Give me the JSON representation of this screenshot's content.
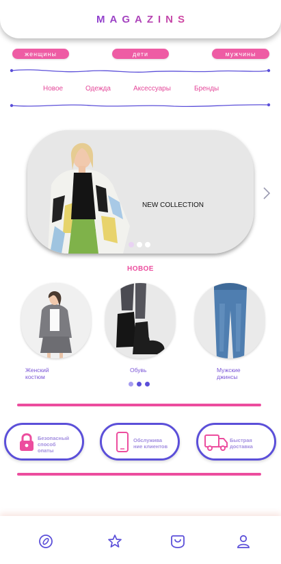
{
  "header": {
    "logo": "MAGAZINS"
  },
  "genders": [
    {
      "label": "женщины"
    },
    {
      "label": "дети"
    },
    {
      "label": "мужчины"
    }
  ],
  "categories": [
    {
      "label": "Новое"
    },
    {
      "label": "Одежда"
    },
    {
      "label": "Аксессуары"
    },
    {
      "label": "Бренды"
    }
  ],
  "hero": {
    "caption": "NEW COLLECTION",
    "slides": 3,
    "active_slide": 1,
    "next_icon": "chevron-right-icon"
  },
  "section": {
    "title": "НОВОЕ"
  },
  "products": [
    {
      "name_line1": "Женский",
      "name_line2": "костюм"
    },
    {
      "name_line1": "Обувь",
      "name_line2": ""
    },
    {
      "name_line1": "Мужские",
      "name_line2": "джинсы"
    }
  ],
  "features": [
    {
      "icon": "lock-icon",
      "line1": "Безопасный",
      "line2": "способ",
      "line3": "опаты"
    },
    {
      "icon": "phone-icon",
      "line1": "Обслужива",
      "line2": "ние клиентов",
      "line3": ""
    },
    {
      "icon": "truck-icon",
      "line1": "Быстрая",
      "line2": "доставка",
      "line3": ""
    }
  ],
  "bottom_nav": [
    {
      "icon": "compass-icon"
    },
    {
      "icon": "star-icon"
    },
    {
      "icon": "bag-icon"
    },
    {
      "icon": "profile-icon"
    }
  ],
  "colors": {
    "accent_pink": "#ec4d9e",
    "accent_purple": "#5b4fd9",
    "logo_gradient_start": "#8a3fd1",
    "logo_gradient_end": "#d3479e"
  }
}
